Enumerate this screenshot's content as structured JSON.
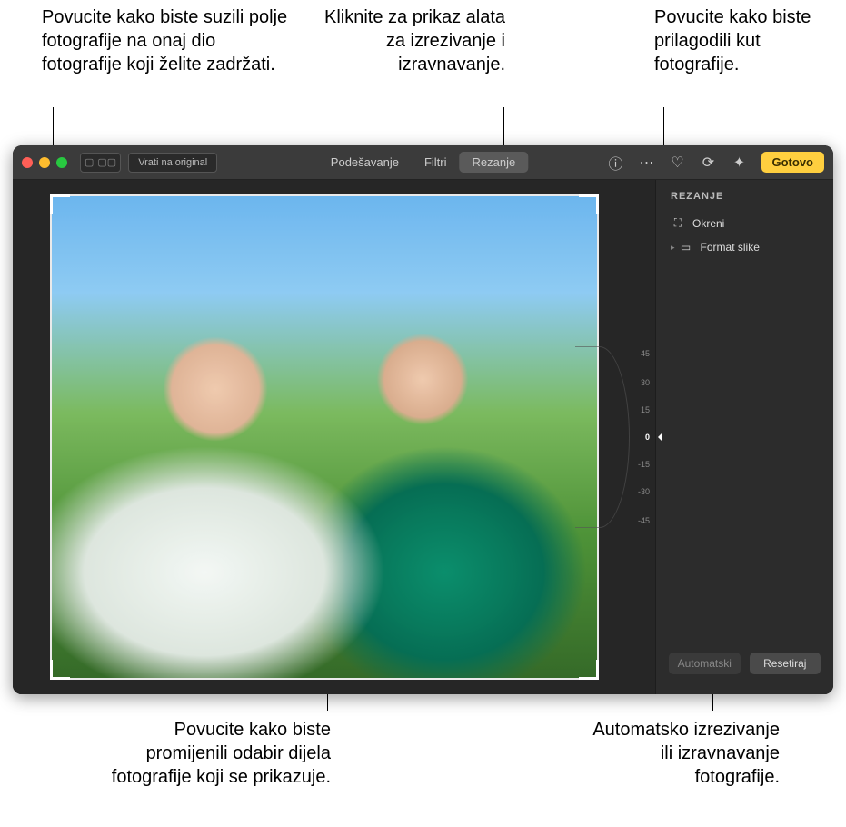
{
  "callouts": {
    "top_left": "Povucite kako biste suzili polje fotografije na onaj dio fotografije koji želite zadržati.",
    "top_mid": "Kliknite za prikaz alata za izrezivanje i izravnavanje.",
    "top_right": "Povucite kako biste prilagodili kut fotografije.",
    "bottom_left": "Povucite kako biste promijenili odabir dijela fotografije koji se prikazuje.",
    "bottom_right": "Automatsko izrezivanje ili izravnavanje fotografije."
  },
  "toolbar": {
    "revert": "Vrati na original",
    "modes": {
      "adjust": "Podešavanje",
      "filters": "Filtri",
      "crop": "Rezanje"
    },
    "done": "Gotovo"
  },
  "dial": {
    "ticks": [
      "45",
      "30",
      "15",
      "0",
      "-15",
      "-30",
      "-45"
    ]
  },
  "panel": {
    "title": "REZANJE",
    "flip": "Okreni",
    "aspect": "Format slike",
    "auto": "Automatski",
    "reset": "Resetiraj"
  }
}
